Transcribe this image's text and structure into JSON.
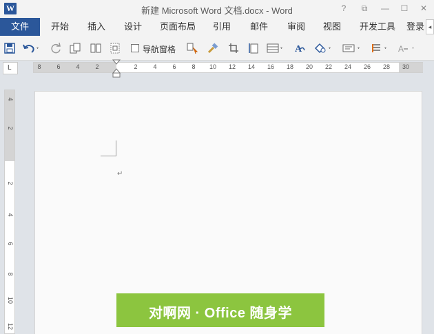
{
  "window": {
    "title": "新建 Microsoft Word 文档.docx - Word",
    "app_icon_letter": "W",
    "help": "?",
    "restore_ribbon": "⧉",
    "minimize": "—",
    "maximize": "☐",
    "close": "✕"
  },
  "tabs": [
    {
      "label": "文件"
    },
    {
      "label": "开始"
    },
    {
      "label": "插入"
    },
    {
      "label": "设计"
    },
    {
      "label": "页面布局"
    },
    {
      "label": "引用"
    },
    {
      "label": "邮件"
    },
    {
      "label": "审阅"
    },
    {
      "label": "视图"
    },
    {
      "label": "开发工具"
    },
    {
      "label": "登录"
    }
  ],
  "tab_more": "◂",
  "toolbar": {
    "nav_pane_label": "导航窗格",
    "nav_pane_checked": false
  },
  "ruler": {
    "corner": "L",
    "h_ticks": [
      "8",
      "6",
      "4",
      "2",
      "2",
      "4",
      "6",
      "8",
      "10",
      "12",
      "14",
      "16",
      "18",
      "20",
      "22",
      "24",
      "26",
      "28",
      "30"
    ],
    "v_ticks": [
      "4",
      "2",
      "2",
      "4",
      "6",
      "8",
      "10",
      "12"
    ]
  },
  "document": {
    "paragraph_mark": "↵"
  },
  "watermark": {
    "text": "对啊网 · Office 随身学",
    "color": "#8cc53f"
  },
  "colors": {
    "accent": "#2b579a"
  }
}
